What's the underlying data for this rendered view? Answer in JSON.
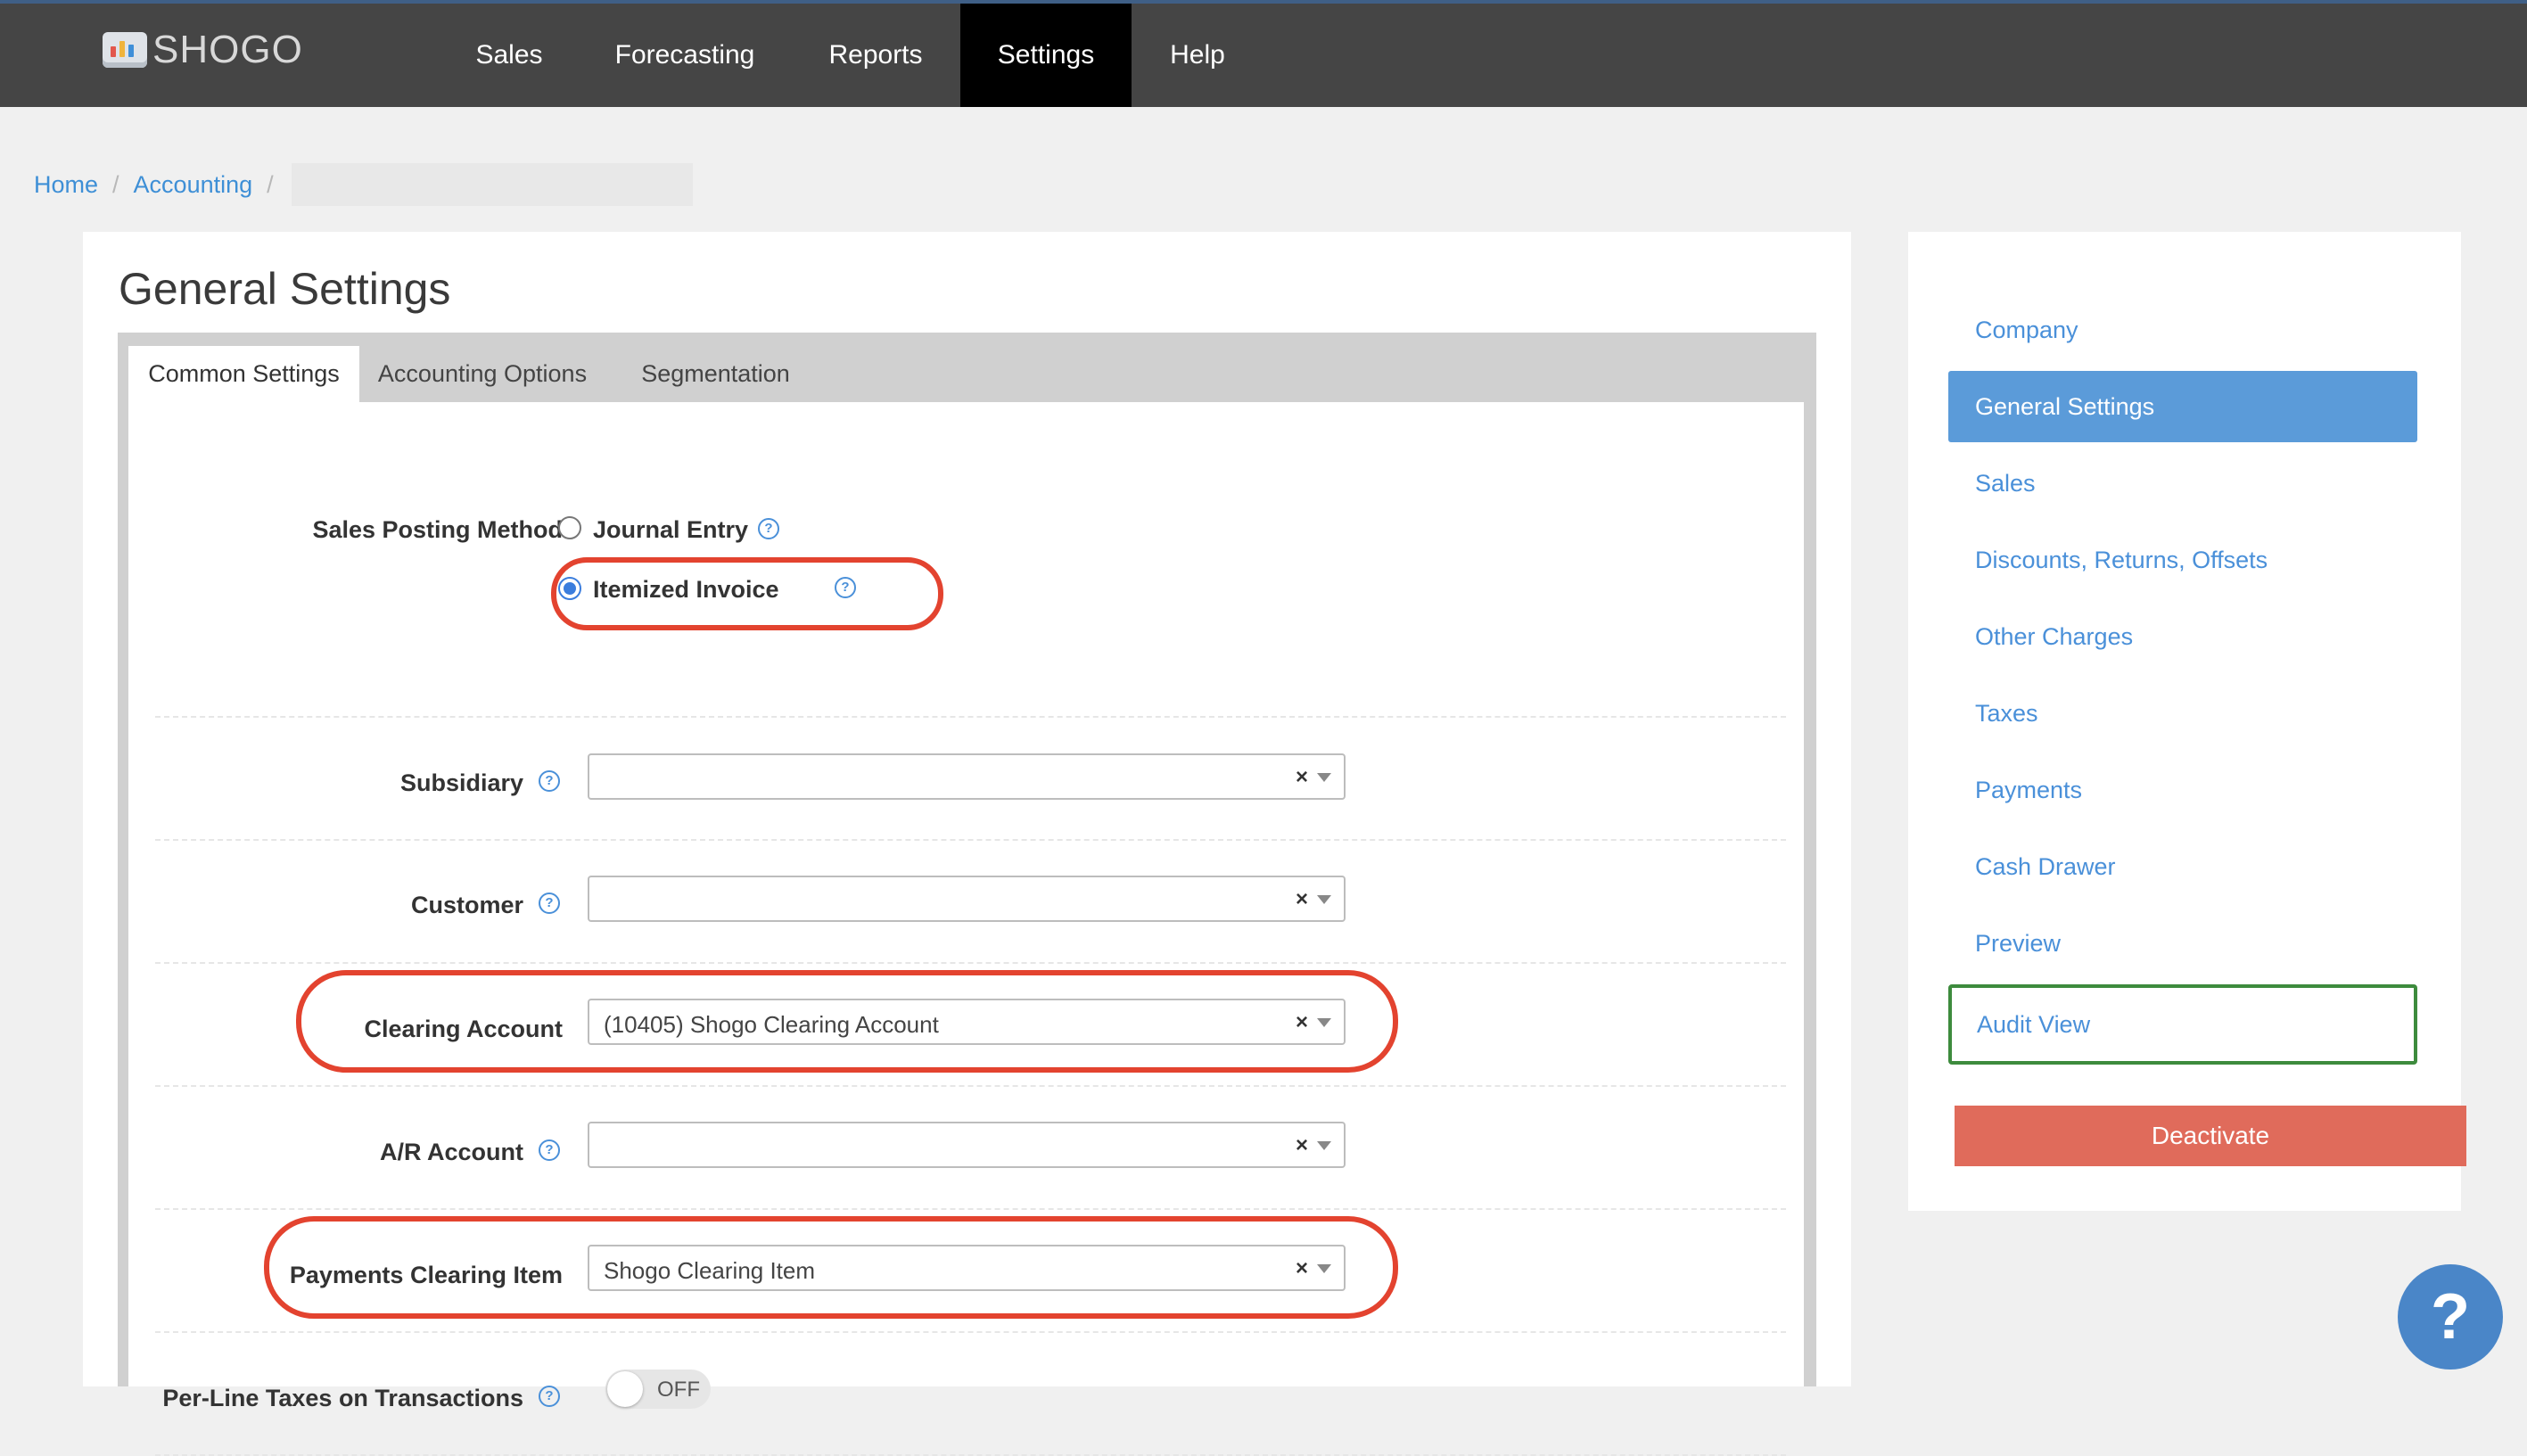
{
  "app": {
    "name": "SHOGO"
  },
  "nav": {
    "items": [
      {
        "label": "Sales"
      },
      {
        "label": "Forecasting"
      },
      {
        "label": "Reports"
      },
      {
        "label": "Settings",
        "active": true
      },
      {
        "label": "Help"
      }
    ]
  },
  "breadcrumb": {
    "home": "Home",
    "accounting": "Accounting",
    "separator": "/"
  },
  "page": {
    "title": "General Settings"
  },
  "tabs": [
    {
      "label": "Common Settings",
      "active": true
    },
    {
      "label": "Accounting Options"
    },
    {
      "label": "Segmentation"
    }
  ],
  "form": {
    "sales_posting_method": {
      "label": "Sales Posting Method",
      "options": [
        {
          "label": "Journal Entry",
          "checked": false
        },
        {
          "label": "Itemized Invoice",
          "checked": true
        }
      ]
    },
    "subsidiary": {
      "label": "Subsidiary",
      "value": ""
    },
    "customer": {
      "label": "Customer",
      "value": ""
    },
    "clearing_account": {
      "label": "Clearing Account",
      "value": "(10405) Shogo Clearing Account"
    },
    "ar_account": {
      "label": "A/R Account",
      "value": ""
    },
    "payments_clearing_item": {
      "label": "Payments Clearing Item",
      "value": "Shogo Clearing Item"
    },
    "per_line_taxes": {
      "label": "Per-Line Taxes on Transactions",
      "state": "OFF"
    },
    "help_glyph": "?",
    "clear_glyph": "×"
  },
  "sidebar": {
    "items": [
      {
        "label": "Company"
      },
      {
        "label": "General Settings",
        "active": true
      },
      {
        "label": "Sales"
      },
      {
        "label": "Discounts, Returns, Offsets"
      },
      {
        "label": "Other Charges"
      },
      {
        "label": "Taxes"
      },
      {
        "label": "Payments"
      },
      {
        "label": "Cash Drawer"
      },
      {
        "label": "Preview"
      },
      {
        "label": "Audit View"
      }
    ],
    "deactivate_label": "Deactivate"
  },
  "help_fab": {
    "label": "?"
  },
  "colors": {
    "topbar": "#454545",
    "accent": "#4a90d9",
    "active_sidebar": "#5b9bd9",
    "highlight": "#e3432f",
    "deactivate": "#e06b5b",
    "audit_border": "#3d8b3d"
  }
}
